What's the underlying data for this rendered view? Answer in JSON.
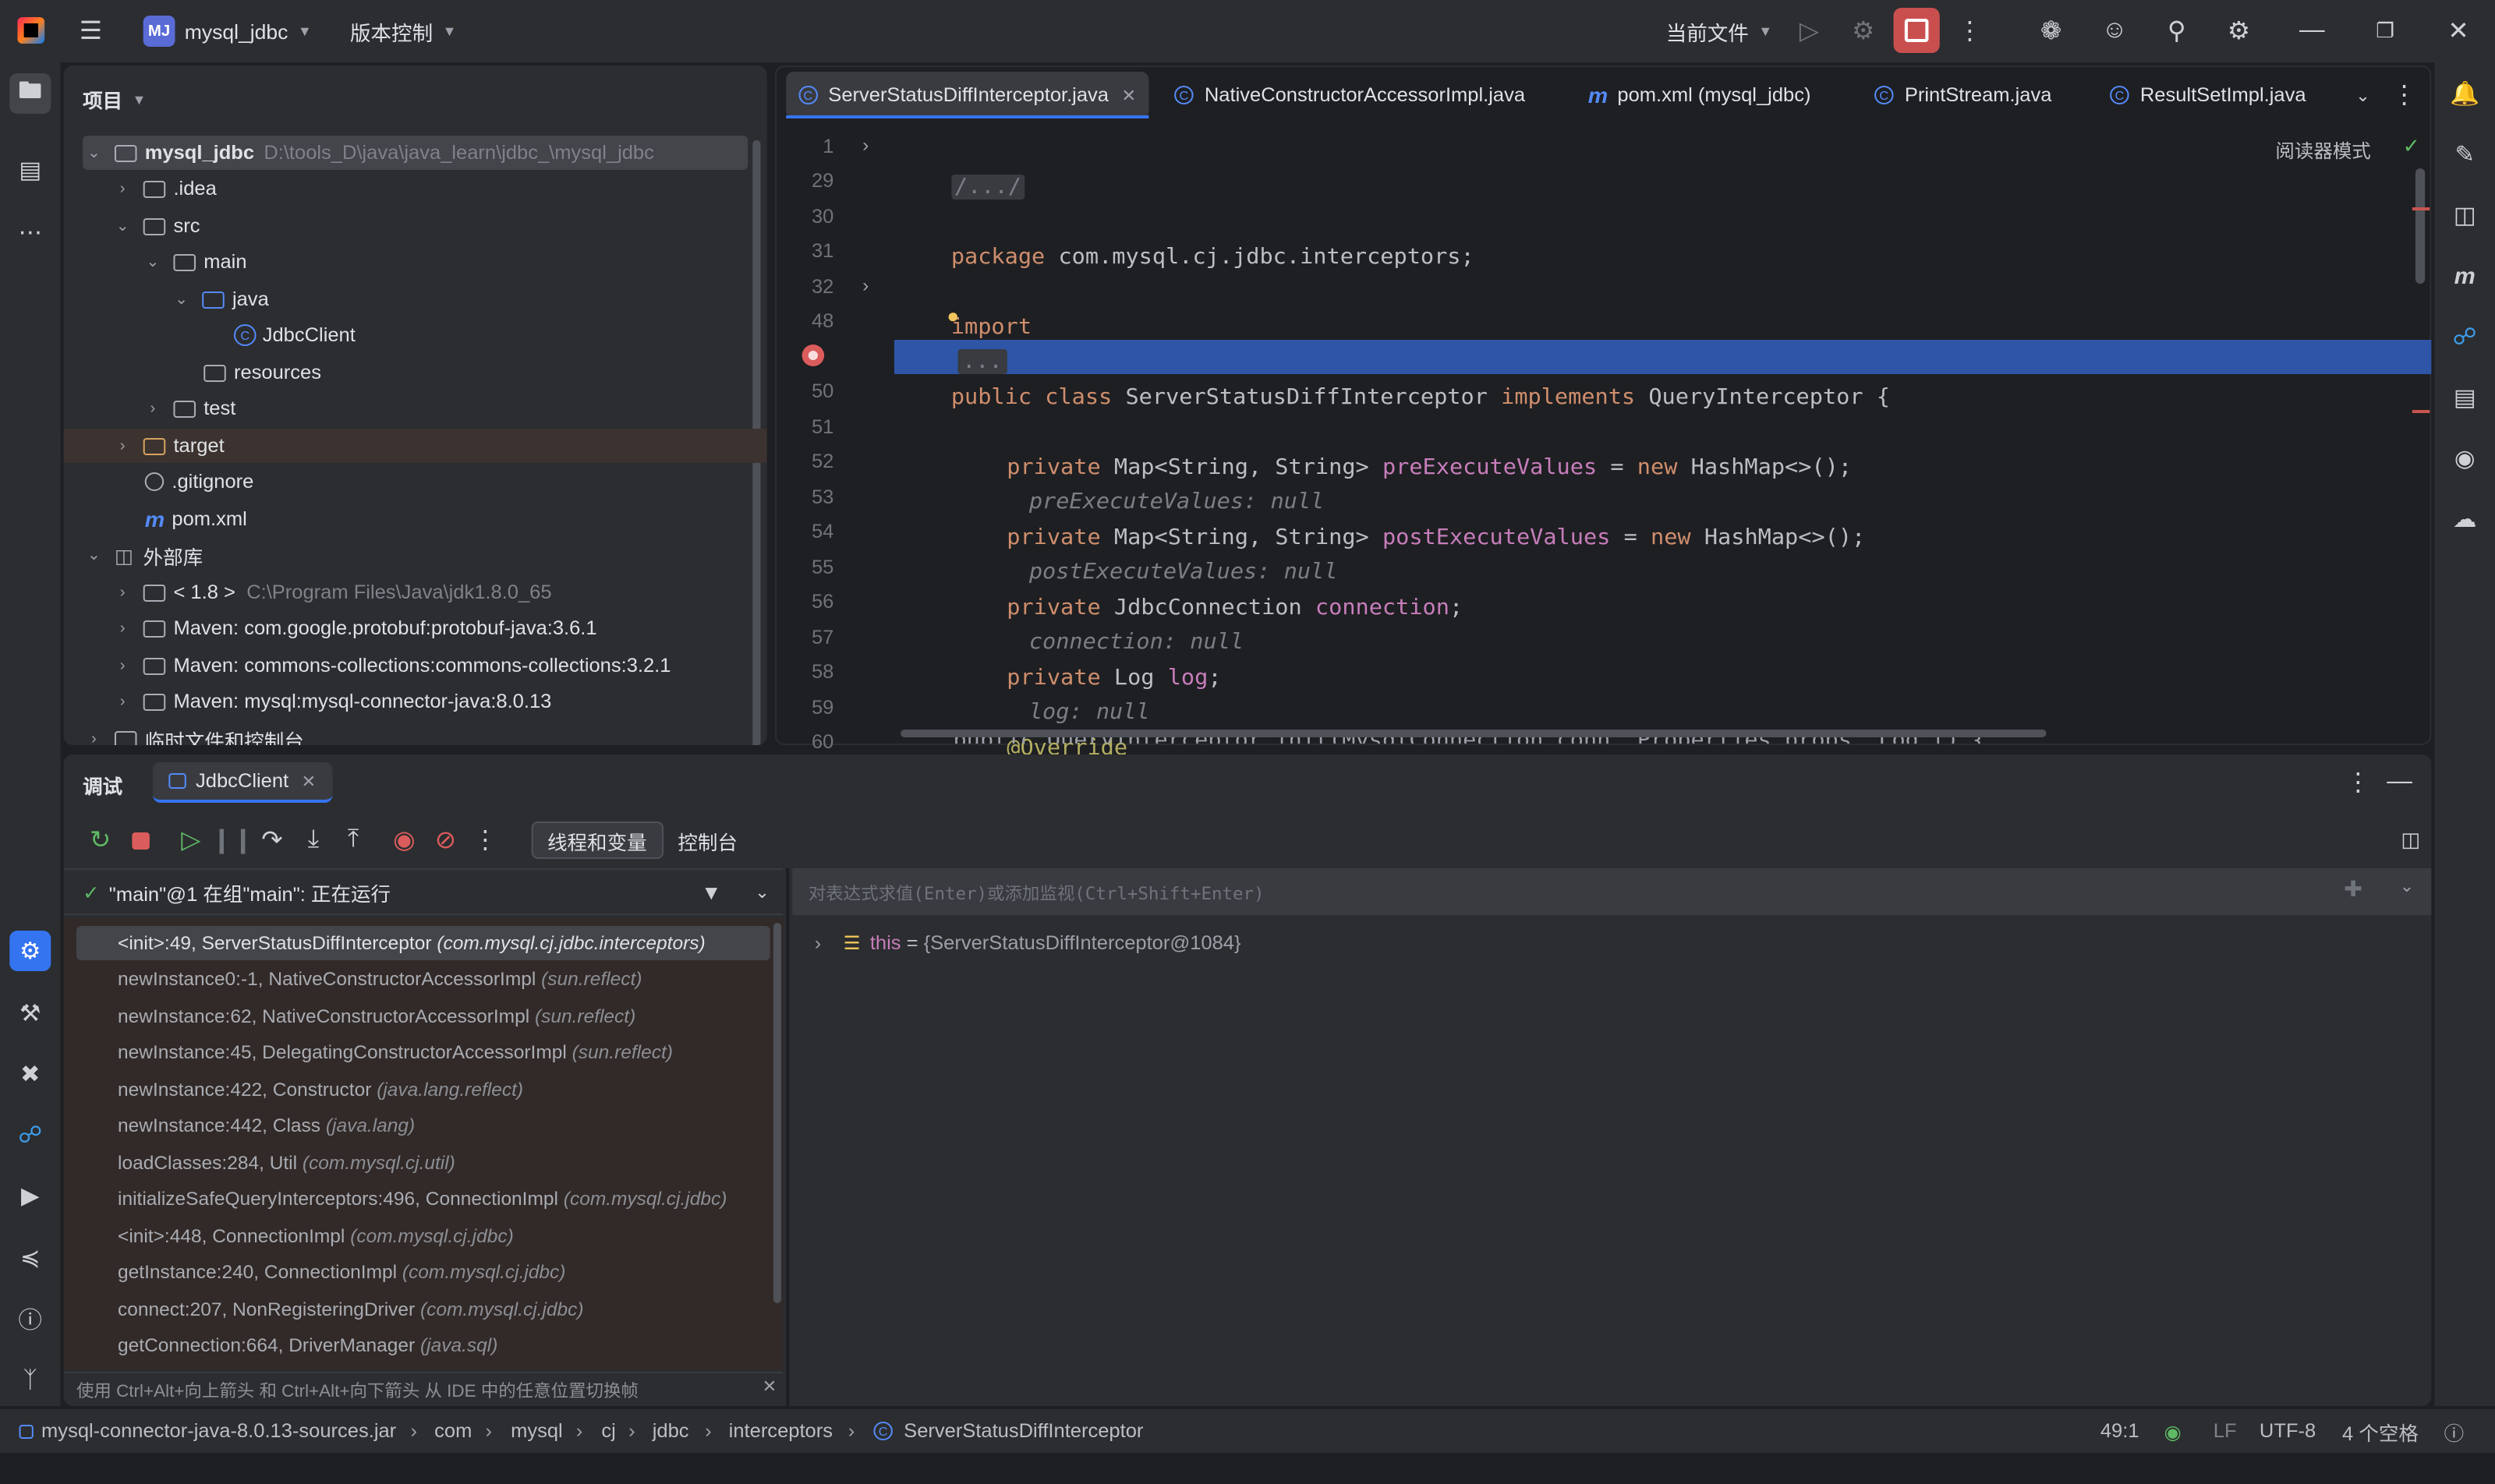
{
  "titlebar": {
    "project_badge": "MJ",
    "project_name": "mysql_jdbc",
    "vcs": "版本控制",
    "run_config": "当前文件"
  },
  "project_panel": {
    "title": "项目",
    "tree": [
      {
        "name": "mysql_jdbc",
        "path": "D:\\tools_D\\java\\java_learn\\jdbc_\\mysql_jdbc"
      },
      {
        "name": ".idea"
      },
      {
        "name": "src"
      },
      {
        "name": "main"
      },
      {
        "name": "java"
      },
      {
        "name": "JdbcClient"
      },
      {
        "name": "resources"
      },
      {
        "name": "test"
      },
      {
        "name": "target"
      },
      {
        "name": ".gitignore"
      },
      {
        "name": "pom.xml"
      },
      {
        "name": "外部库"
      },
      {
        "name": "< 1.8 >",
        "path": "C:\\Program Files\\Java\\jdk1.8.0_65"
      },
      {
        "name": "Maven: com.google.protobuf:protobuf-java:3.6.1"
      },
      {
        "name": "Maven: commons-collections:commons-collections:3.2.1"
      },
      {
        "name": "Maven: mysql:mysql-connector-java:8.0.13"
      },
      {
        "name": "临时文件和控制台"
      }
    ]
  },
  "editor": {
    "tabs": [
      {
        "label": "ServerStatusDiffInterceptor.java"
      },
      {
        "label": "NativeConstructorAccessorImpl.java"
      },
      {
        "label": "pom.xml (mysql_jdbc)"
      },
      {
        "label": "PrintStream.java"
      },
      {
        "label": "ResultSetImpl.java"
      }
    ],
    "reader_mode": "阅读器模式",
    "line_numbers": [
      "1",
      "29",
      "30",
      "31",
      "32",
      "48",
      "49",
      "50",
      "51",
      "52",
      "53",
      "54",
      "55",
      "56",
      "57",
      "58",
      "59",
      "60"
    ],
    "code": {
      "l1": "/.../",
      "l30_kw": "package",
      "l30_rest": " com.mysql.cj.jdbc.interceptors;",
      "l32_kw": "import",
      "l32_fold": "...",
      "l49_kw1": "public class",
      "l49_cls": " ServerStatusDiffInterceptor ",
      "l49_kw2": "implements",
      "l49_rest": " QueryInterceptor {",
      "l51_kw": "private",
      "l51_type": " Map<String, String> ",
      "l51_field": "preExecuteValues",
      "l51_mid": " = ",
      "l51_new": "new",
      "l51_end": " HashMap<>();",
      "l51_hint": "preExecuteValues: null",
      "l53_kw": "private",
      "l53_type": " Map<String, String> ",
      "l53_field": "postExecuteValues",
      "l53_mid": " = ",
      "l53_new": "new",
      "l53_end": " HashMap<>();",
      "l53_hint": "postExecuteValues: null",
      "l55_kw": "private",
      "l55_type": " JdbcConnection ",
      "l55_field": "connection",
      "l55_end": ";",
      "l55_hint": "connection: null",
      "l57_kw": "private",
      "l57_type": " Log ",
      "l57_field": "log",
      "l57_end": ";",
      "l57_hint": "log: null",
      "l59_ann": "@Override",
      "l60_partial": "public QueryInterceptor init(MysqlConnection conn, Properties props, Log l) {"
    }
  },
  "debug": {
    "title": "调试",
    "session_tab": "JdbcClient",
    "tabs": [
      "线程和变量",
      "控制台"
    ],
    "thread_status": "\"main\"@1 在组\"main\": 正在运行",
    "frames": [
      {
        "method": "<init>:49, ServerStatusDiffInterceptor",
        "pkg": "(com.mysql.cj.jdbc.interceptors)"
      },
      {
        "method": "newInstance0:-1, NativeConstructorAccessorImpl",
        "pkg": "(sun.reflect)"
      },
      {
        "method": "newInstance:62, NativeConstructorAccessorImpl",
        "pkg": "(sun.reflect)"
      },
      {
        "method": "newInstance:45, DelegatingConstructorAccessorImpl",
        "pkg": "(sun.reflect)"
      },
      {
        "method": "newInstance:422, Constructor",
        "pkg": "(java.lang.reflect)"
      },
      {
        "method": "newInstance:442, Class",
        "pkg": "(java.lang)"
      },
      {
        "method": "loadClasses:284, Util",
        "pkg": "(com.mysql.cj.util)"
      },
      {
        "method": "initializeSafeQueryInterceptors:496, ConnectionImpl",
        "pkg": "(com.mysql.cj.jdbc)"
      },
      {
        "method": "<init>:448, ConnectionImpl",
        "pkg": "(com.mysql.cj.jdbc)"
      },
      {
        "method": "getInstance:240, ConnectionImpl",
        "pkg": "(com.mysql.cj.jdbc)"
      },
      {
        "method": "connect:207, NonRegisteringDriver",
        "pkg": "(com.mysql.cj.jdbc)"
      },
      {
        "method": "getConnection:664, DriverManager",
        "pkg": "(java.sql)"
      }
    ],
    "frames_hint": "使用 Ctrl+Alt+向上箭头 和 Ctrl+Alt+向下箭头 从 IDE 中的任意位置切换帧",
    "eval_placeholder": "对表达式求值(Enter)或添加监视(Ctrl+Shift+Enter)",
    "variable": {
      "name": "this",
      "eq": " = ",
      "value": "{ServerStatusDiffInterceptor@1084}"
    }
  },
  "statusbar": {
    "breadcrumb": [
      "mysql-connector-java-8.0.13-sources.jar",
      "com",
      "mysql",
      "cj",
      "jdbc",
      "interceptors",
      "ServerStatusDiffInterceptor"
    ],
    "position": "49:1",
    "line_sep": "LF",
    "encoding": "UTF-8",
    "indent": "4 个空格"
  },
  "colors": {
    "accent": "#2e55a6",
    "stop_red": "#c94f4f",
    "breakpoint": "#db5c5c"
  }
}
